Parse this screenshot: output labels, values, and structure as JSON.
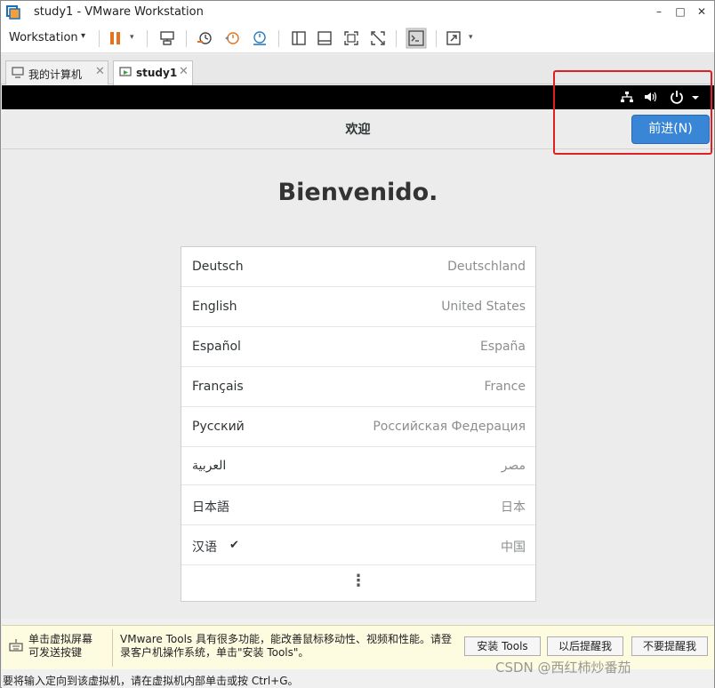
{
  "window": {
    "title": "study1 - VMware Workstation",
    "minimize_glyph": "–",
    "maximize_glyph": "□",
    "close_glyph": "✕"
  },
  "toolbar": {
    "workstation_menu": "Workstation",
    "caret": "▾",
    "icons": [
      "pause-icon",
      "send-keys-icon",
      "snapshot-icon",
      "revert-snapshot-icon",
      "snapshot-manager-icon",
      "sidebar-icon",
      "thumbnail-icon",
      "fullscreen-icon",
      "unity-icon",
      "console-icon",
      "stretch-icon"
    ]
  },
  "tabs": [
    {
      "label": "我的计算机",
      "close": "✕",
      "active": false
    },
    {
      "label": "study1",
      "close": "✕",
      "active": true
    }
  ],
  "guest": {
    "header_title": "欢迎",
    "next_button": "前进(N)",
    "welcome": "Bienvenido.",
    "languages": [
      {
        "name": "Deutsch",
        "region": "Deutschland",
        "selected": false
      },
      {
        "name": "English",
        "region": "United States",
        "selected": false
      },
      {
        "name": "Español",
        "region": "España",
        "selected": false
      },
      {
        "name": "Français",
        "region": "France",
        "selected": false
      },
      {
        "name": "Русский",
        "region": "Российская Федерация",
        "selected": false
      },
      {
        "name": "العربية",
        "region": "مصر",
        "selected": false
      },
      {
        "name": "日本語",
        "region": "日本",
        "selected": false
      },
      {
        "name": "汉语",
        "region": "中国",
        "selected": true
      }
    ],
    "check_glyph": "✔",
    "more_glyph": "⋮",
    "accent_color": "#3a86d6"
  },
  "notification": {
    "left_line1": "单击虚拟屏幕",
    "left_line2": "可发送按键",
    "message_line1": "VMware Tools 具有很多功能，能改善鼠标移动性、视频和性能。请登",
    "message_line2": "录客户机操作系统，单击\"安装 Tools\"。",
    "install_button": "安装 Tools",
    "remind_later_button": "以后提醒我",
    "never_remind_button": "不要提醒我"
  },
  "status": {
    "text": "要将输入定向到该虚拟机，请在虚拟机内部单击或按 Ctrl+G。"
  },
  "watermark": "CSDN @西红柿炒番茄"
}
